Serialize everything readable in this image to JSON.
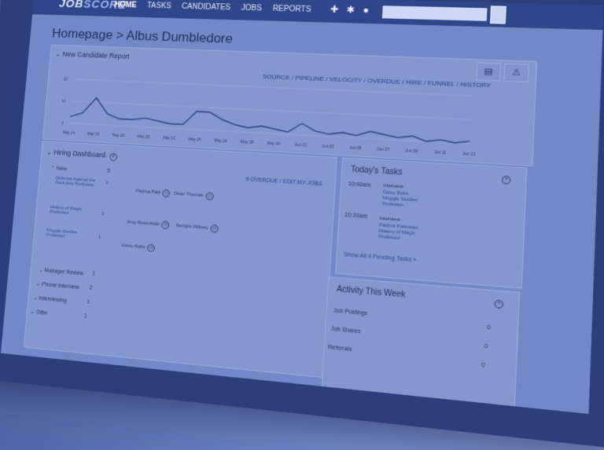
{
  "nav": {
    "logo_pre": "JOB",
    "logo_post": "SCORE",
    "items": [
      "HOME",
      "TASKS",
      "CANDIDATES",
      "JOBS",
      "REPORTS"
    ]
  },
  "page_title": "Homepage > Albus Dumbledore",
  "report": {
    "title": "New Candidate Report",
    "links": "SOURCE / PIPELINE / VELOCITY / OVERDUE / HIRE / FUNNEL / HISTORY",
    "y_ticks": [
      "20",
      "10",
      "0"
    ],
    "x_labels": [
      "May 14",
      "May 16",
      "May 18",
      "May 20",
      "May 22",
      "May 24",
      "May 26",
      "May 28",
      "May 30",
      "Jun 01",
      "Jun 03",
      "Jun 05",
      "Jun 07",
      "Jun 09",
      "Jun 11",
      "Jun 13"
    ]
  },
  "chart_data": {
    "type": "line",
    "x": [
      "May 14",
      "May 15",
      "May 16",
      "May 17",
      "May 18",
      "May 19",
      "May 20",
      "May 21",
      "May 22",
      "May 23",
      "May 24",
      "May 25",
      "May 26",
      "May 27",
      "May 28",
      "May 29",
      "May 30",
      "May 31",
      "Jun 01",
      "Jun 02",
      "Jun 03",
      "Jun 04",
      "Jun 05",
      "Jun 06",
      "Jun 07",
      "Jun 08",
      "Jun 09",
      "Jun 10",
      "Jun 11",
      "Jun 12",
      "Jun 13"
    ],
    "values": [
      3,
      5,
      12,
      5,
      3,
      3,
      4,
      3,
      2,
      2,
      8,
      8,
      5,
      3,
      2,
      3,
      2,
      1,
      5,
      2,
      1,
      2,
      1,
      3,
      2,
      1,
      2,
      0,
      1,
      0,
      1
    ],
    "ylim": [
      0,
      20
    ],
    "grid": true
  },
  "hiring": {
    "title": "Hiring Dashboard",
    "overdue_link": "9 OVERDUE / EDIT MY JOBS",
    "new_label": "New",
    "new_count": "5",
    "rows": [
      {
        "job": "Defense Against the Dark Arts Professor",
        "count": "2",
        "people": [
          "Padma Patil",
          "Dean Thomas"
        ]
      },
      {
        "job": "History of Magic Professor",
        "count": "2",
        "people": [
          "Amy Rosenblatt",
          "Benigie Wiltsey"
        ]
      },
      {
        "job": "Muggle Studies Professor",
        "count": "1",
        "people": [
          "Daisy Bobs"
        ]
      }
    ],
    "stages": [
      {
        "name": "Manager Review",
        "count": "1"
      },
      {
        "name": "Phone Interview",
        "count": "2"
      },
      {
        "name": "Interviewing",
        "count": "1"
      },
      {
        "name": "Offer",
        "count": "1"
      }
    ]
  },
  "tasks": {
    "title": "Today's Tasks",
    "items": [
      {
        "time": "10:00am",
        "type": "Interview",
        "lines": [
          "Daisy Bobs",
          "Muggle Studies",
          "Professor"
        ]
      },
      {
        "time": "10:20am",
        "type": "Interview",
        "lines": [
          "Padma Pattinson",
          "History of Magic",
          "Professor"
        ]
      }
    ],
    "show_all": "Show All 4 Pending Tasks »"
  },
  "activity": {
    "title": "Activity This Week",
    "rows": [
      {
        "label": "Job Postings",
        "value": "0"
      },
      {
        "label": "Job Shares",
        "value": "0"
      },
      {
        "label": "Referrals",
        "value": "0"
      }
    ]
  }
}
